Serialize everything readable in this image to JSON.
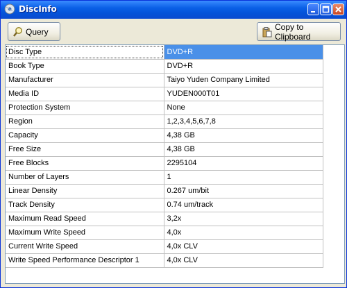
{
  "window": {
    "title": "DiscInfo"
  },
  "toolbar": {
    "query_label": "Query",
    "copy_label": "Copy to Clipboard"
  },
  "properties": [
    {
      "name": "Disc Type",
      "value": "DVD+R"
    },
    {
      "name": "Book Type",
      "value": "DVD+R"
    },
    {
      "name": "Manufacturer",
      "value": "Taiyo Yuden Company Limited"
    },
    {
      "name": "Media ID",
      "value": "YUDEN000T01"
    },
    {
      "name": "Protection System",
      "value": "None"
    },
    {
      "name": "Region",
      "value": "1,2,3,4,5,6,7,8"
    },
    {
      "name": "Capacity",
      "value": "4,38 GB"
    },
    {
      "name": "Free Size",
      "value": "4,38 GB"
    },
    {
      "name": "Free Blocks",
      "value": "2295104"
    },
    {
      "name": "Number of Layers",
      "value": "1"
    },
    {
      "name": "Linear Density",
      "value": "0.267 um/bit"
    },
    {
      "name": "Track Density",
      "value": "0.74 um/track"
    },
    {
      "name": "Maximum Read Speed",
      "value": "3,2x"
    },
    {
      "name": "Maximum Write Speed",
      "value": "4,0x"
    },
    {
      "name": "Current Write Speed",
      "value": "4,0x CLV"
    },
    {
      "name": "Write Speed Performance Descriptor 1",
      "value": "4,0x CLV"
    }
  ],
  "colors": {
    "titlebar": "#0a5fe6",
    "selection": "#4a90e8",
    "face": "#ece9d8"
  },
  "icons": [
    "disc-icon",
    "minimize-icon",
    "maximize-icon",
    "close-icon",
    "magnifier-icon",
    "clipboard-icon"
  ]
}
